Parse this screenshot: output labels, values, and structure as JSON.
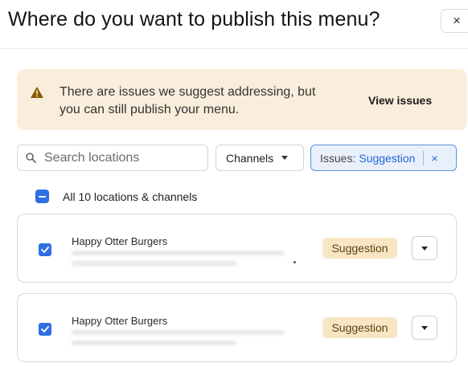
{
  "dialog": {
    "title": "Where do you want to publish this menu?",
    "close_glyph": "×"
  },
  "banner": {
    "icon": "warning-icon",
    "message": "There are issues we suggest addressing, but you can still publish your menu.",
    "action_label": "View issues"
  },
  "filters": {
    "search_placeholder": "Search locations",
    "channels_label": "Channels",
    "issues_chip": {
      "prefix": "Issues:",
      "value": "Suggestion",
      "remove_glyph": "×"
    }
  },
  "select_all": {
    "label": "All 10 locations & channels",
    "state": "indeterminate"
  },
  "locations": [
    {
      "name": "Happy Otter Burgers",
      "badge": "Suggestion",
      "checked": true
    },
    {
      "name": "Happy Otter Burgers",
      "badge": "Suggestion",
      "checked": true
    }
  ],
  "colors": {
    "accent": "#2f6fe4",
    "banner_bg": "#f9eedb",
    "suggestion_badge_bg": "#f7e6c4",
    "warning_icon": "#8a5a00"
  }
}
